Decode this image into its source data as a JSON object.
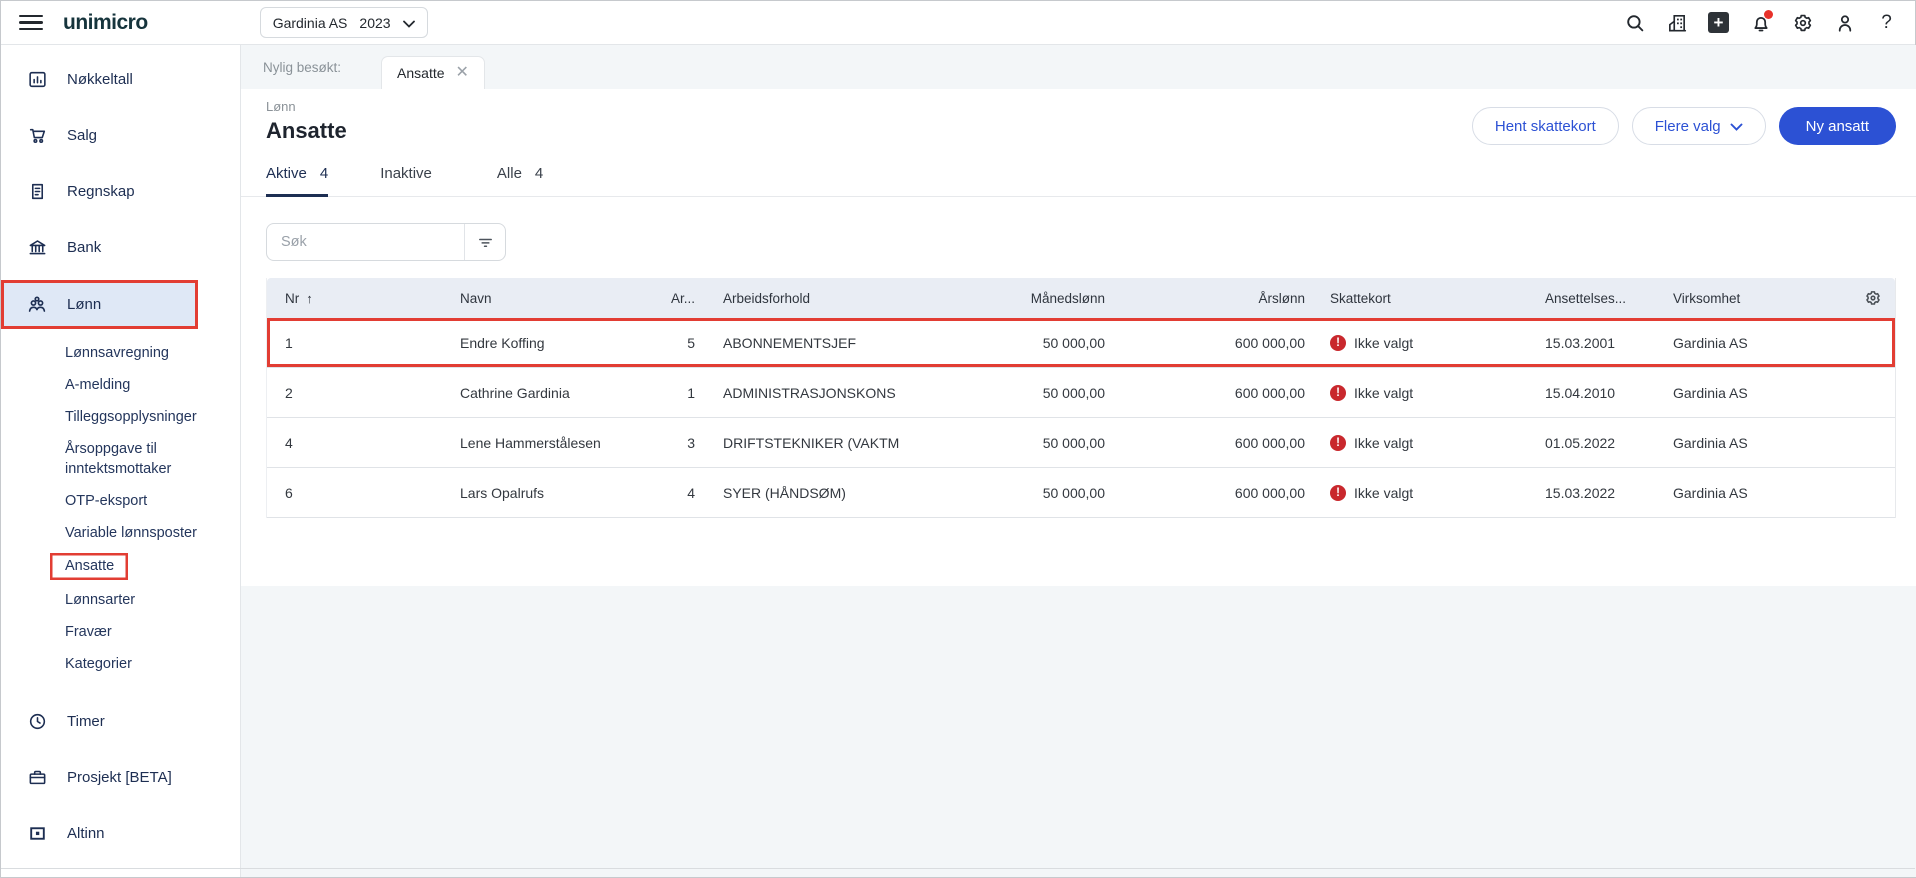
{
  "topbar": {
    "logo": "unimicro",
    "company_selector": {
      "company": "Gardinia AS",
      "year": "2023"
    },
    "icons": [
      "search-icon",
      "company-icon",
      "add-icon",
      "notifications-icon",
      "settings-icon",
      "profile-icon",
      "help-icon"
    ],
    "notification_dot_color": "#e8322a"
  },
  "sidebar": {
    "items": [
      {
        "id": "nokkeltall",
        "icon": "bar-chart-icon",
        "label": "Nøkkeltall"
      },
      {
        "id": "salg",
        "icon": "cart-icon",
        "label": "Salg"
      },
      {
        "id": "regnskap",
        "icon": "invoice-icon",
        "label": "Regnskap"
      },
      {
        "id": "bank",
        "icon": "bank-icon",
        "label": "Bank"
      },
      {
        "id": "lonn",
        "icon": "people-icon",
        "label": "Lønn",
        "active": true,
        "annotated": true,
        "children": [
          {
            "id": "lonnsavregning",
            "label": "Lønnsavregning"
          },
          {
            "id": "a-melding",
            "label": "A-melding"
          },
          {
            "id": "tilleggsopplysninger",
            "label": "Tilleggsopplysninger"
          },
          {
            "id": "arsoppgave",
            "label": "Årsoppgave til inntektsmottaker"
          },
          {
            "id": "otp-eksport",
            "label": "OTP-eksport"
          },
          {
            "id": "variable-lonnsposter",
            "label": "Variable lønnsposter"
          },
          {
            "id": "ansatte",
            "label": "Ansatte",
            "annotated": true
          },
          {
            "id": "lonnsarter",
            "label": "Lønnsarter"
          },
          {
            "id": "fravaer",
            "label": "Fravær"
          },
          {
            "id": "kategorier",
            "label": "Kategorier"
          }
        ]
      },
      {
        "id": "timer",
        "icon": "clock-icon",
        "label": "Timer"
      },
      {
        "id": "prosjekt",
        "icon": "briefcase-icon",
        "label": "Prosjekt [BETA]"
      },
      {
        "id": "altinn",
        "icon": "altinn-icon",
        "label": "Altinn"
      }
    ]
  },
  "main": {
    "recent_label": "Nylig besøkt:",
    "recent_tab": "Ansatte",
    "pretitle": "Lønn",
    "title": "Ansatte",
    "actions": {
      "secondary": "Hent skattekort",
      "dropdown": "Flere valg",
      "primary": "Ny ansatt"
    },
    "tabs": [
      {
        "label": "Aktive",
        "count": "4",
        "active": true
      },
      {
        "label": "Inaktive",
        "count": ""
      },
      {
        "label": "Alle",
        "count": "4"
      }
    ],
    "search_placeholder": "Søk",
    "table": {
      "columns": [
        "Nr",
        "Navn",
        "Ar...",
        "Arbeidsforhold",
        "Månedslønn",
        "Årslønn",
        "Skattekort",
        "Ansettelses...",
        "Virksomhet"
      ],
      "sorted_column": "Nr",
      "sort_direction": "ascending",
      "rows": [
        {
          "nr": "1",
          "navn": "Endre Koffing",
          "ar": "5",
          "arbeidsforhold": "ABONNEMENTSJEF",
          "manedslonn": "50 000,00",
          "arslonn": "600 000,00",
          "skattekort": "Ikke valgt",
          "ansettelsesdato": "15.03.2001",
          "virksomhet": "Gardinia AS",
          "annotated": true
        },
        {
          "nr": "2",
          "navn": "Cathrine Gardinia",
          "ar": "1",
          "arbeidsforhold": "ADMINISTRASJONSKONS",
          "manedslonn": "50 000,00",
          "arslonn": "600 000,00",
          "skattekort": "Ikke valgt",
          "ansettelsesdato": "15.04.2010",
          "virksomhet": "Gardinia AS"
        },
        {
          "nr": "4",
          "navn": "Lene Hammerstålesen",
          "ar": "3",
          "arbeidsforhold": "DRIFTSTEKNIKER (VAKTM",
          "manedslonn": "50 000,00",
          "arslonn": "600 000,00",
          "skattekort": "Ikke valgt",
          "ansettelsesdato": "01.05.2022",
          "virksomhet": "Gardinia AS"
        },
        {
          "nr": "6",
          "navn": "Lars Opalrufs",
          "ar": "4",
          "arbeidsforhold": "SYER (HÅNDSØM)",
          "manedslonn": "50 000,00",
          "arslonn": "600 000,00",
          "skattekort": "Ikke valgt",
          "ansettelsesdato": "15.03.2022",
          "virksomhet": "Gardinia AS"
        }
      ]
    }
  },
  "annotations": {
    "color": "#e23d33",
    "targets": [
      "sidebar-item-lonn",
      "sidebar-subitem-ansatte",
      "table-row-1"
    ]
  },
  "colors": {
    "accent_blue": "#2c51d4",
    "navy": "#1d2e52",
    "alert_red": "#c9282d",
    "annotation_red": "#e23d33",
    "header_bg": "#e9edf4"
  }
}
